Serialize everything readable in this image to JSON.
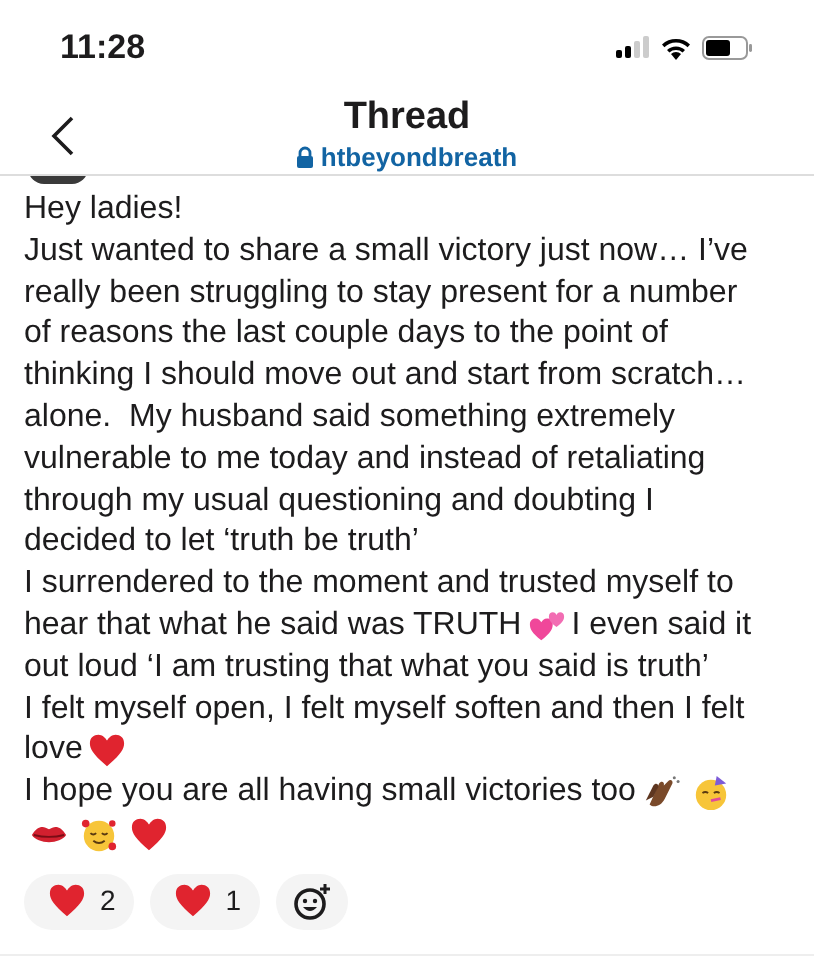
{
  "status_bar": {
    "time": "11:28"
  },
  "header": {
    "title": "Thread",
    "channel": "htbeyondbreath",
    "private": true
  },
  "post": {
    "lines": [
      [
        {
          "kind": "text",
          "text": "Hey ladies!"
        }
      ],
      [
        {
          "kind": "text",
          "text": "Just wanted to share a small victory just now… I’ve"
        }
      ],
      [
        {
          "kind": "text",
          "text": "really been struggling to stay present for a number"
        }
      ],
      [
        {
          "kind": "text",
          "text": "of reasons the last couple days to the point of"
        }
      ],
      [
        {
          "kind": "text",
          "text": "thinking I should move out and start from scratch…"
        }
      ],
      [
        {
          "kind": "text",
          "text": "alone.  My husband said something extremely"
        }
      ],
      [
        {
          "kind": "text",
          "text": "vulnerable to me today and instead of retaliating"
        }
      ],
      [
        {
          "kind": "text",
          "text": "through my usual questioning and doubting I"
        }
      ],
      [
        {
          "kind": "text",
          "text": "decided to let ‘truth be truth’"
        }
      ],
      [
        {
          "kind": "text",
          "text": "I surrendered to the moment and trusted myself to"
        }
      ],
      [
        {
          "kind": "text",
          "text": "hear that what he said was TRUTH"
        },
        {
          "kind": "two-hearts"
        },
        {
          "kind": "text",
          "text": "I even said it"
        }
      ],
      [
        {
          "kind": "text",
          "text": "out loud ‘I am trusting that what you said is truth’"
        }
      ],
      [
        {
          "kind": "text",
          "text": "I felt myself open, I felt myself soften and then I felt"
        }
      ],
      [
        {
          "kind": "text",
          "text": "love"
        },
        {
          "kind": "heart"
        }
      ],
      [
        {
          "kind": "text",
          "text": "I hope you are all having small victories too"
        },
        {
          "kind": "clap"
        },
        {
          "kind": "party"
        }
      ],
      [
        {
          "kind": "kiss"
        },
        {
          "kind": "smile-hearts"
        },
        {
          "kind": "heart"
        }
      ]
    ]
  },
  "reactions": [
    {
      "kind": "heart",
      "count": "2"
    },
    {
      "kind": "heart",
      "count": "1"
    }
  ]
}
